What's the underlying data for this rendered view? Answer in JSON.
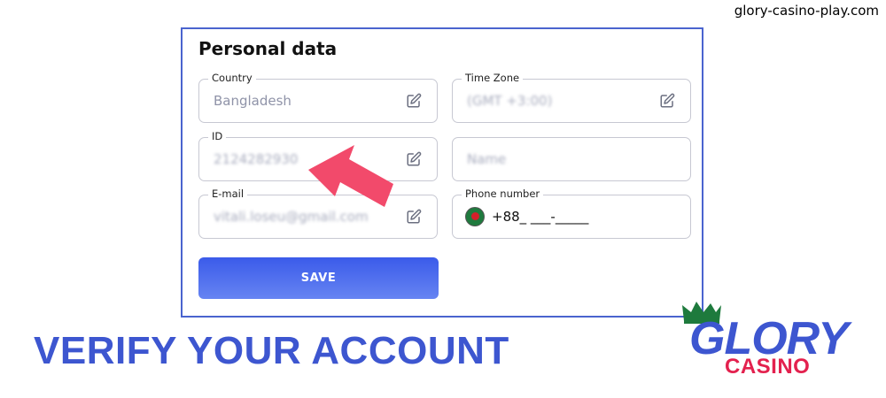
{
  "site_watermark": "glory-casino-play.com",
  "form": {
    "title": "Personal data",
    "fields": {
      "country": {
        "label": "Country",
        "value": "Bangladesh"
      },
      "timezone": {
        "label": "Time Zone",
        "value": "(GMT +3:00)"
      },
      "id": {
        "label": "ID",
        "value": "2124282930"
      },
      "name": {
        "placeholder": "Name"
      },
      "email": {
        "label": "E-mail",
        "value": "vitali.loseu@gmail.com"
      },
      "phone": {
        "label": "Phone number",
        "value": "+88_ ___-_____",
        "flag_icon": "bangladesh-flag"
      }
    },
    "save_label": "SAVE"
  },
  "headline": "VERIFY YOUR ACCOUNT",
  "logo": {
    "primary": "GLORY",
    "secondary": "CASINO"
  },
  "colors": {
    "accent_blue": "#3d56d0",
    "arrow_pink": "#f24a6b",
    "logo_red": "#e3214e",
    "logo_green": "#1e7a3d"
  }
}
